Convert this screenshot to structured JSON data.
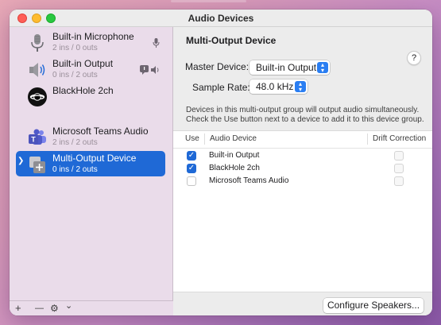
{
  "window": {
    "title": "Audio Devices"
  },
  "sidebar": {
    "devices": [
      {
        "name": "Built-in Microphone",
        "io": "2 ins / 0 outs",
        "icon": "microphone-icon",
        "badge": "mic-input-icon"
      },
      {
        "name": "Built-in Output",
        "io": "0 ins / 2 outs",
        "icon": "speaker-icon",
        "badge": "speaker-output-icon"
      },
      {
        "name": "BlackHole 2ch",
        "io": "2 ins / 2 outs",
        "icon": "blackhole-icon"
      },
      {
        "name": "Microsoft Teams Audio",
        "io": "2 ins / 2 outs",
        "icon": "teams-icon"
      },
      {
        "name": "Multi-Output Device",
        "io": "0 ins / 2 outs",
        "icon": "multi-output-icon",
        "selected": true
      }
    ],
    "footer": {
      "add": "+",
      "remove": "—",
      "gear": "⚙",
      "chevron": "⌄"
    }
  },
  "main": {
    "title": "Multi-Output Device",
    "help": "?",
    "master_label": "Master Device:",
    "master_value": "Built-in Output",
    "rate_label": "Sample Rate:",
    "rate_value": "48.0 kHz",
    "description": "Devices in this multi-output group will output audio simultaneously. Check the Use button next to a device to add it to this device group.",
    "table": {
      "headers": [
        "Use",
        "Audio Device",
        "Drift Correction"
      ],
      "rows": [
        {
          "device": "Built-in Output",
          "use": true,
          "drift": false
        },
        {
          "device": "BlackHole 2ch",
          "use": true,
          "drift": false
        },
        {
          "device": "Microsoft Teams Audio",
          "use": false,
          "drift": false
        }
      ]
    },
    "configure_button": "Configure Speakers..."
  },
  "colors": {
    "accent": "#1f69d6",
    "sidebar": "#eadcea",
    "close": "#ff5f57",
    "minimize": "#febc2e",
    "maximize": "#28c840"
  }
}
